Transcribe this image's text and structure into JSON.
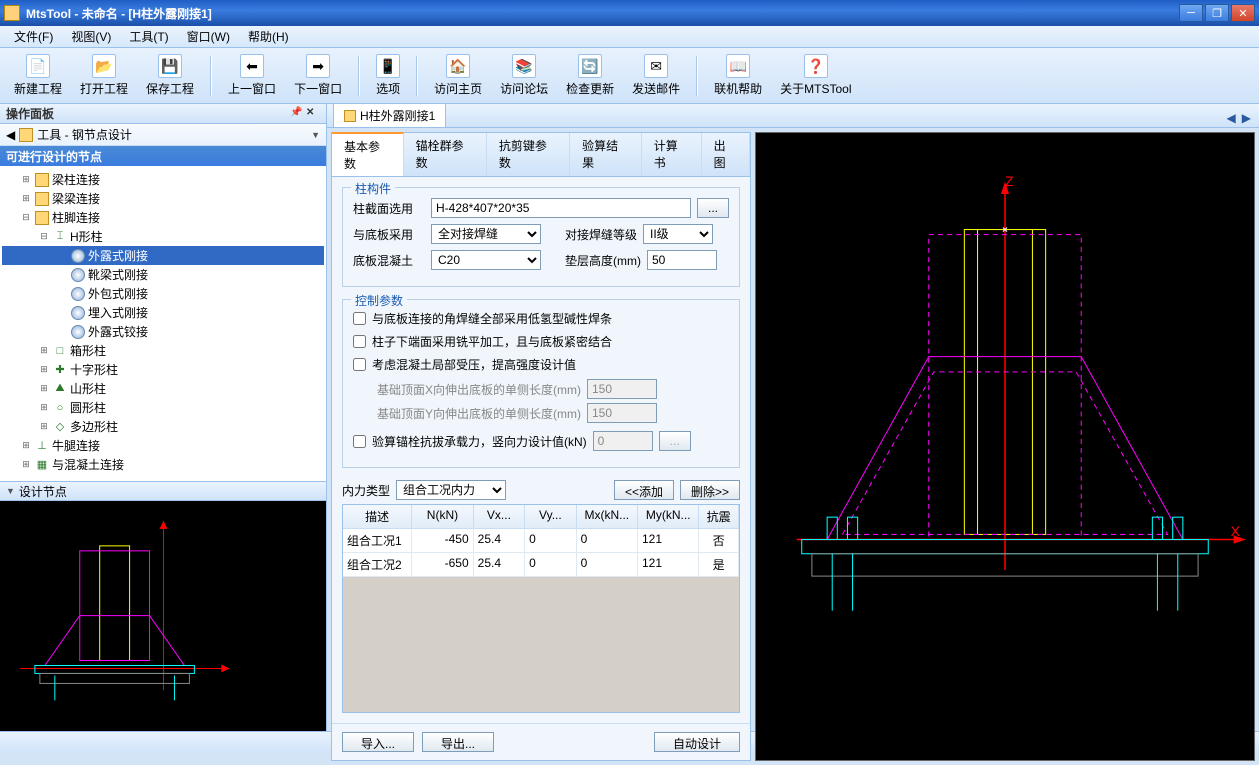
{
  "title": "MtsTool - 未命名 - [H柱外露刚接1]",
  "menu": [
    "文件(F)",
    "视图(V)",
    "工具(T)",
    "窗口(W)",
    "帮助(H)"
  ],
  "toolbar": [
    {
      "label": "新建工程",
      "icon": "📄"
    },
    {
      "label": "打开工程",
      "icon": "📂"
    },
    {
      "label": "保存工程",
      "icon": "💾"
    },
    {
      "label": "上一窗口",
      "icon": "⬅"
    },
    {
      "label": "下一窗口",
      "icon": "➡"
    },
    {
      "label": "选项",
      "icon": "📱"
    },
    {
      "label": "访问主页",
      "icon": "🏠"
    },
    {
      "label": "访问论坛",
      "icon": "📚"
    },
    {
      "label": "检查更新",
      "icon": "🔄"
    },
    {
      "label": "发送邮件",
      "icon": "✉"
    },
    {
      "label": "联机帮助",
      "icon": "📖"
    },
    {
      "label": "关于MTSTool",
      "icon": "❓"
    }
  ],
  "tool_sep_after": [
    2,
    4,
    5,
    9
  ],
  "leftPanel": {
    "title": "操作面板",
    "toolRow": "工具 - 钢节点设计",
    "sectionHeader": "可进行设计的节点",
    "previewTitle": "设计节点"
  },
  "tree": [
    {
      "d": 1,
      "t": "+",
      "i": "folder",
      "l": "梁柱连接"
    },
    {
      "d": 1,
      "t": "+",
      "i": "folder",
      "l": "梁梁连接"
    },
    {
      "d": 1,
      "t": "-",
      "i": "folder",
      "l": "柱脚连接"
    },
    {
      "d": 2,
      "t": "-",
      "i": "shape",
      "g": "⌶",
      "l": "H形柱"
    },
    {
      "d": 3,
      "t": "",
      "i": "item",
      "l": "外露式刚接",
      "sel": true
    },
    {
      "d": 3,
      "t": "",
      "i": "item",
      "l": "靴梁式刚接"
    },
    {
      "d": 3,
      "t": "",
      "i": "item",
      "l": "外包式刚接"
    },
    {
      "d": 3,
      "t": "",
      "i": "item",
      "l": "埋入式刚接"
    },
    {
      "d": 3,
      "t": "",
      "i": "item",
      "l": "外露式铰接"
    },
    {
      "d": 2,
      "t": "+",
      "i": "shape",
      "g": "□",
      "l": "箱形柱"
    },
    {
      "d": 2,
      "t": "+",
      "i": "shape",
      "g": "✚",
      "l": "十字形柱"
    },
    {
      "d": 2,
      "t": "+",
      "i": "shape",
      "g": "⛰",
      "l": "山形柱"
    },
    {
      "d": 2,
      "t": "+",
      "i": "shape",
      "g": "○",
      "l": "圆形柱"
    },
    {
      "d": 2,
      "t": "+",
      "i": "shape",
      "g": "◇",
      "l": "多边形柱"
    },
    {
      "d": 1,
      "t": "+",
      "i": "shape",
      "g": "⊥",
      "l": "牛腿连接"
    },
    {
      "d": 1,
      "t": "+",
      "i": "shape",
      "g": "▦",
      "l": "与混凝土连接"
    }
  ],
  "docTab": "H柱外露刚接1",
  "formTabs": [
    "基本参数",
    "锚栓群参数",
    "抗剪键参数",
    "验算结果",
    "计算书",
    "出图"
  ],
  "section1": {
    "legend": "柱构件",
    "row1_label": "柱截面选用",
    "row1_value": "H-428*407*20*35",
    "row1_btn": "...",
    "row2_label": "与底板采用",
    "row2_value": "全对接焊缝",
    "row2b_label": "对接焊缝等级",
    "row2b_value": "II级",
    "row3_label": "底板混凝土",
    "row3_value": "C20",
    "row3b_label": "垫层高度(mm)",
    "row3b_value": "50"
  },
  "section2": {
    "legend": "控制参数",
    "cb1": "与底板连接的角焊缝全部采用低氢型碱性焊条",
    "cb2": "柱子下端面采用铣平加工，且与底板紧密结合",
    "cb3": "考虑混凝土局部受压，提高强度设计值",
    "sub1_label": "基础顶面X向伸出底板的单侧长度(mm)",
    "sub1_value": "150",
    "sub2_label": "基础顶面Y向伸出底板的单侧长度(mm)",
    "sub2_value": "150",
    "cb4": "验算锚栓抗拔承载力，竖向力设计值(kN)",
    "cb4_value": "0",
    "cb4_btn": "..."
  },
  "gridBar": {
    "label": "内力类型",
    "combo": "组合工况内力",
    "addBtn": "<<添加",
    "delBtn": "删除>>"
  },
  "gridHead": [
    "描述",
    "N(kN)",
    "Vx...",
    "Vy...",
    "Mx(kN...",
    "My(kN...",
    "抗震"
  ],
  "gridRows": [
    [
      "组合工况1",
      "-450",
      "25.4",
      "0",
      "0",
      "121",
      "否"
    ],
    [
      "组合工况2",
      "-650",
      "25.4",
      "0",
      "0",
      "121",
      "是"
    ]
  ],
  "footer": {
    "import": "导入...",
    "export": "导出...",
    "auto": "自动设计"
  },
  "axes": {
    "z": "Z",
    "x": "X"
  }
}
